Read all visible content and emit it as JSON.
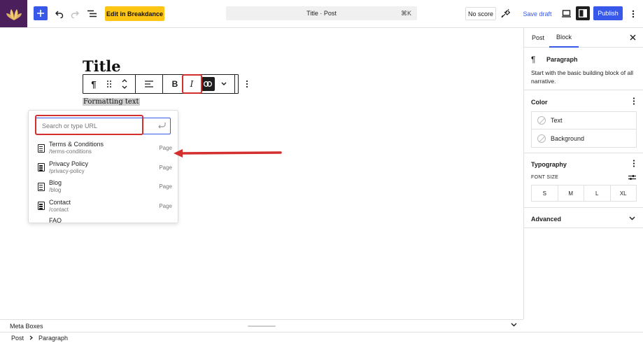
{
  "header": {
    "builder_label": "Edit in Breakdance",
    "command_title": "Title · Post",
    "command_shortcut": "⌘K",
    "seo_score": "No score",
    "save_label": "Save draft",
    "publish_label": "Publish"
  },
  "editor": {
    "post_title": "Title",
    "paragraph_text": "Formatting text",
    "toolbar": {
      "paragraph_icon": "¶",
      "bold": "B",
      "italic": "I"
    },
    "link_popover": {
      "placeholder": "Search or type URL",
      "results": [
        {
          "title": "Terms & Conditions",
          "slug": "/terms-conditions",
          "type": "Page"
        },
        {
          "title": "Privacy Policy",
          "slug": "/privacy-policy",
          "type": "Page"
        },
        {
          "title": "Blog",
          "slug": "/blog",
          "type": "Page"
        },
        {
          "title": "Contact",
          "slug": "/contact",
          "type": "Page"
        },
        {
          "title": "FAQ",
          "slug": "",
          "type": ""
        }
      ]
    }
  },
  "sidebar": {
    "tabs": [
      "Post",
      "Block"
    ],
    "active_tab": "Block",
    "block": {
      "icon": "¶",
      "name": "Paragraph",
      "description": "Start with the basic building block of all narrative."
    },
    "color": {
      "title": "Color",
      "items": [
        "Text",
        "Background"
      ]
    },
    "typography": {
      "title": "Typography",
      "font_size_label": "FONT SIZE",
      "sizes": [
        "S",
        "M",
        "L",
        "XL"
      ]
    },
    "advanced": {
      "title": "Advanced"
    }
  },
  "bottom": {
    "meta_boxes": "Meta Boxes",
    "breadcrumb": [
      "Post",
      "Paragraph"
    ]
  },
  "colors": {
    "accent": "#3858e9",
    "annotation": "#d42f2f",
    "breakdance": "#ffc514"
  }
}
